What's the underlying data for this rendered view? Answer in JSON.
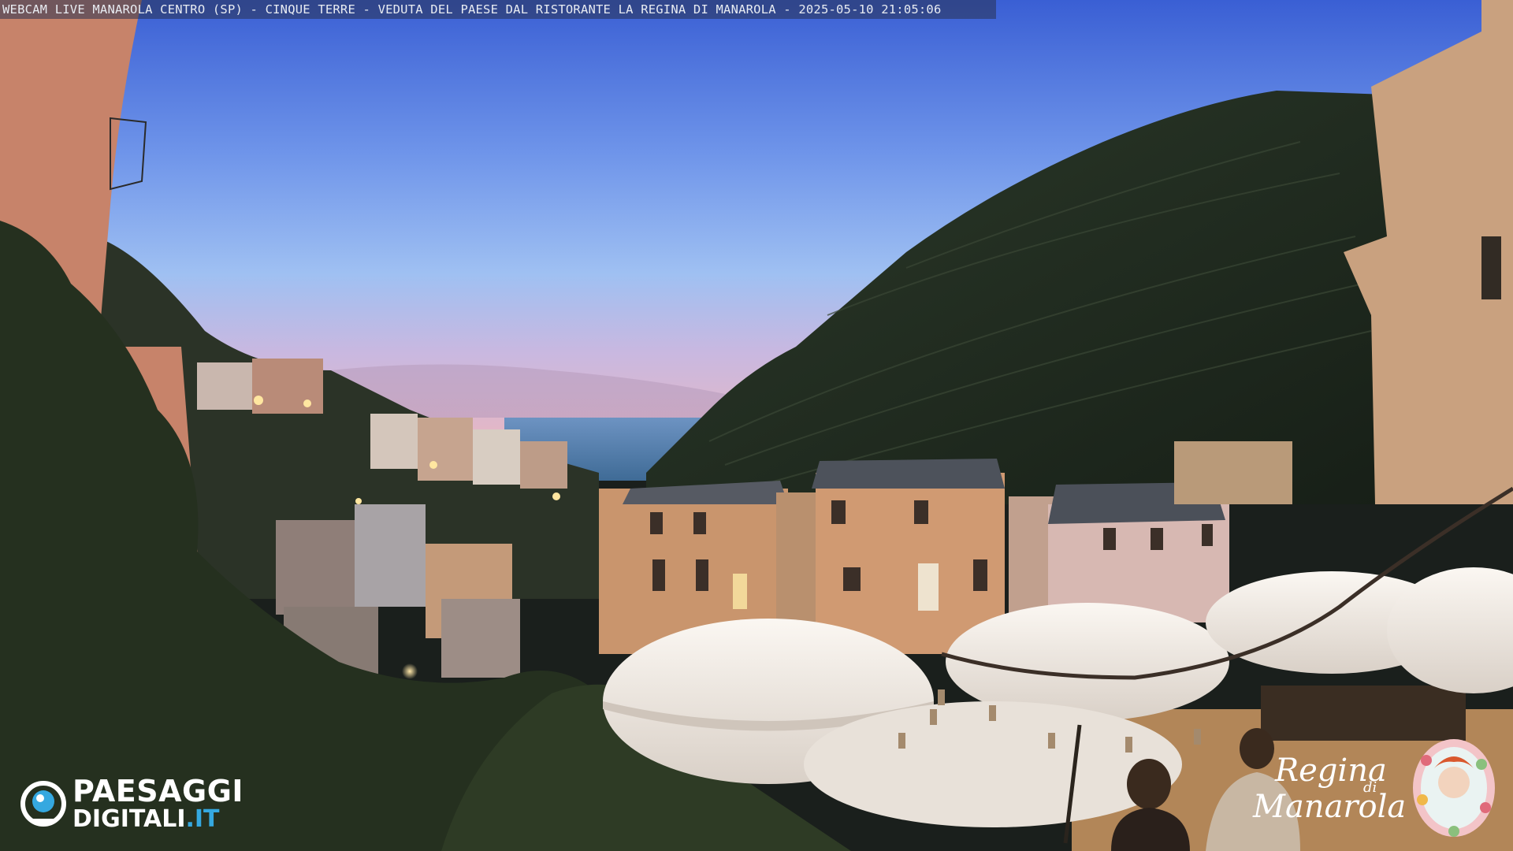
{
  "overlay": {
    "caption": "WEBCAM LIVE MANAROLA CENTRO (SP) - CINQUE TERRE - VEDUTA DEL PAESE DAL RISTORANTE LA REGINA DI MANAROLA - 2025-05-10 21:05:06"
  },
  "logos": {
    "left_line1": "PAESAGGI",
    "left_line2_main": "DIGITALI",
    "left_line2_suffix": ".IT",
    "left_accent_color": "#35a8e0",
    "right_signature_line1": "Regina",
    "right_signature_small": "di",
    "right_signature_line2": "Manarola"
  },
  "scene_colors": {
    "sky_top": "#3f66d6",
    "sky_mid": "#7ea4ef",
    "sky_horizon": "#d9b8d8",
    "sea": "#4a7aa6",
    "hill": "#1e2a1f",
    "building_warm": "#c9956d",
    "umbrella": "#f1ece6"
  }
}
